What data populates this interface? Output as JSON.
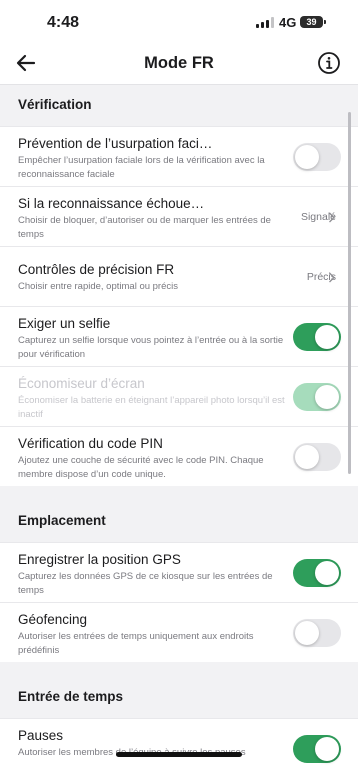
{
  "status_bar": {
    "time": "4:48",
    "network": "4G",
    "battery": "39"
  },
  "header": {
    "title": "Mode FR",
    "back_icon": "arrow-left-icon",
    "info_icon": "info-circle-icon"
  },
  "colors": {
    "toggle_on": "#2e9e5b",
    "toggle_on_disabled": "#a6dcbc",
    "toggle_off": "#e6e6e9",
    "background": "#f2f2f4"
  },
  "sections": {
    "verification": {
      "header": "Vérification",
      "rows": [
        {
          "title": "Prévention de l’usurpation faci…",
          "subtitle": "Empêcher l’usurpation faciale lors de la vérification avec la reconnaissance faciale",
          "toggle": false
        },
        {
          "title": "Si la reconnaissance échoue…",
          "subtitle": "Choisir de bloquer, d’autoriser ou de marquer les entrées de temps",
          "value": "Signalé"
        },
        {
          "title": "Contrôles de précision FR",
          "subtitle": "Choisir entre rapide, optimal ou précis",
          "value": "Précis"
        },
        {
          "title": "Exiger un selfie",
          "subtitle": "Capturez un selfie lorsque vous pointez à l’entrée ou à la sortie pour vérification",
          "toggle": true
        },
        {
          "title": "Économiseur d’écran",
          "subtitle": "Économiser la batterie en éteignant l’appareil photo lorsqu’il est inactif",
          "toggle": true,
          "disabled": true
        },
        {
          "title": "Vérification du code PIN",
          "subtitle": "Ajoutez une couche de sécurité avec le code PIN. Chaque membre dispose d’un code unique.",
          "toggle": false
        }
      ]
    },
    "location": {
      "header": "Emplacement",
      "rows": [
        {
          "title": "Enregistrer la position GPS",
          "subtitle": "Capturez les données GPS de ce kiosque sur les entrées de temps",
          "toggle": true
        },
        {
          "title": "Géofencing",
          "subtitle": "Autoriser les entrées de temps uniquement aux endroits prédéfinis",
          "toggle": false
        }
      ]
    },
    "time_entry": {
      "header": "Entrée de temps",
      "rows": [
        {
          "title": "Pauses",
          "subtitle": "Autoriser les membres de l’équipe à suivre les pauses",
          "toggle": true
        }
      ]
    }
  }
}
